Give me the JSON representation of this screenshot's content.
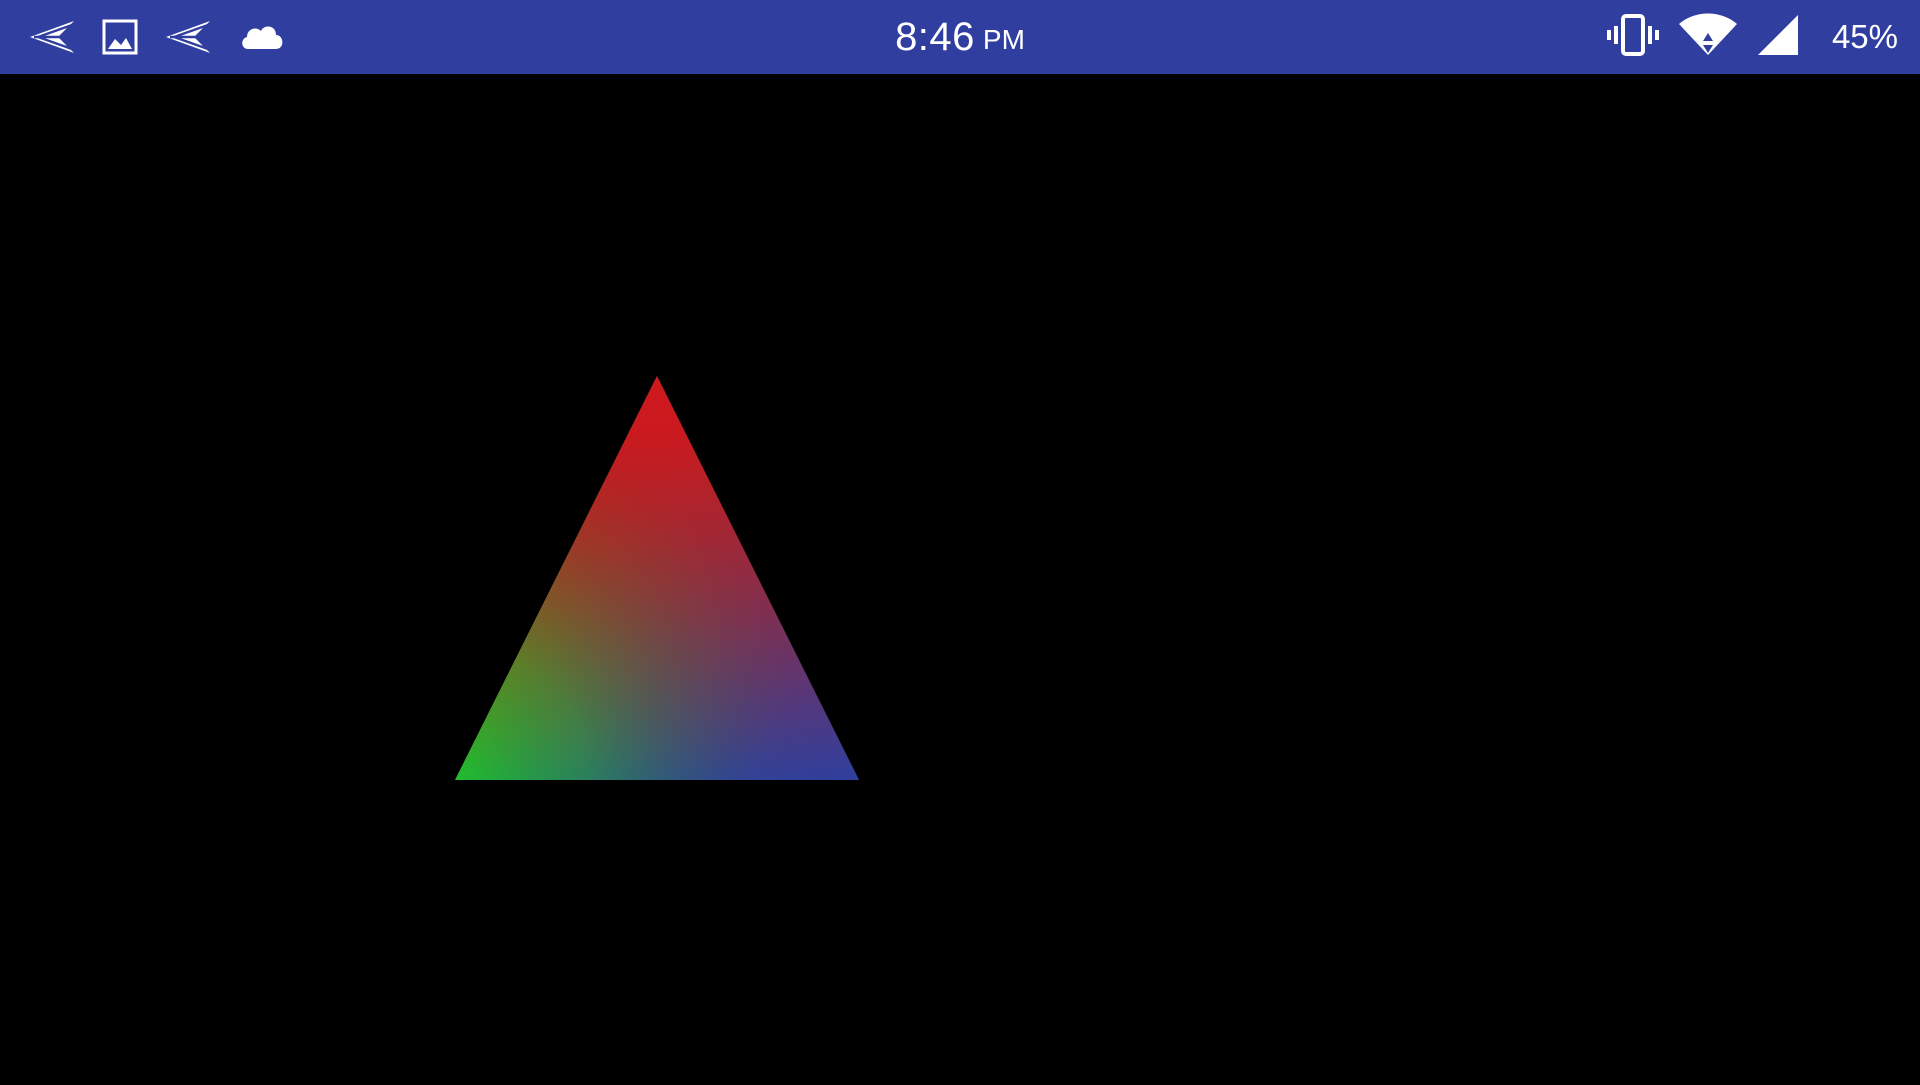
{
  "status_bar": {
    "background": "#303f9f",
    "time": "8:46",
    "ampm": "PM",
    "battery_text": "45%",
    "left_icons": [
      "paper-plane-icon",
      "image-icon",
      "paper-plane-icon",
      "cloud-icon"
    ],
    "right_icons": [
      "vibrate-icon",
      "wifi-icon",
      "cell-signal-icon"
    ]
  },
  "scene": {
    "background": "#000000",
    "triangle": {
      "vertex_colors": {
        "top": "#d0181e",
        "bottom_left": "#1ec823",
        "bottom_right": "#2f3f9f"
      }
    }
  }
}
